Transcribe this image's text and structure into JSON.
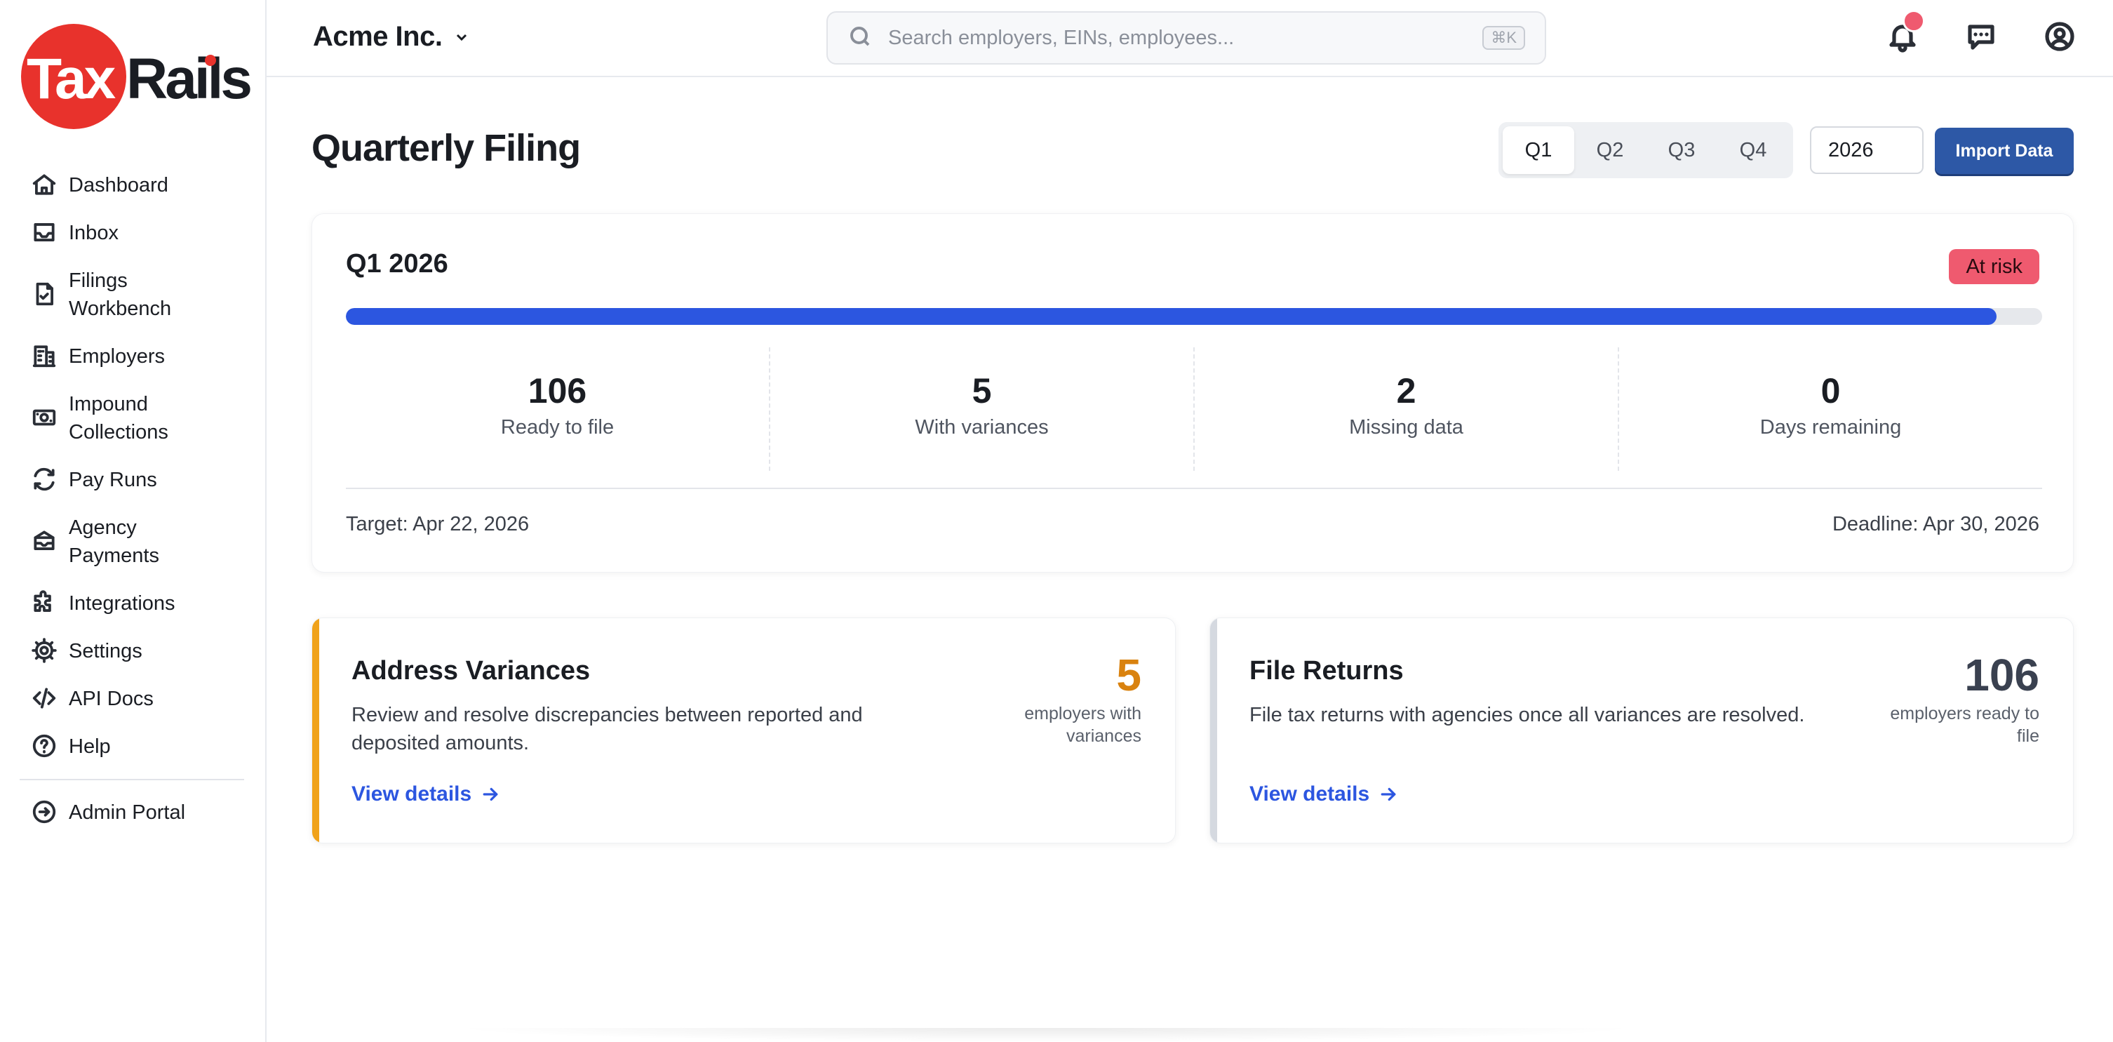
{
  "brand": {
    "logo_part1": "Tax",
    "logo_part2": "Rails",
    "accent_color": "#e8322c"
  },
  "sidebar": {
    "items": [
      {
        "label": "Dashboard",
        "icon": "home-icon"
      },
      {
        "label": "Inbox",
        "icon": "inbox-icon"
      },
      {
        "label": "Filings Workbench",
        "icon": "file-check-icon"
      },
      {
        "label": "Employers",
        "icon": "building-icon"
      },
      {
        "label": "Impound Collections",
        "icon": "money-icon"
      },
      {
        "label": "Pay Runs",
        "icon": "refresh-icon"
      },
      {
        "label": "Agency Payments",
        "icon": "bank-icon"
      },
      {
        "label": "Integrations",
        "icon": "puzzle-icon"
      },
      {
        "label": "Settings",
        "icon": "gear-icon"
      },
      {
        "label": "API Docs",
        "icon": "code-icon"
      },
      {
        "label": "Help",
        "icon": "help-icon"
      }
    ],
    "footer_item": {
      "label": "Admin Portal",
      "icon": "arrow-circle-icon"
    }
  },
  "header": {
    "org_name": "Acme Inc.",
    "search_placeholder": "Search employers, EINs, employees...",
    "search_shortcut": "⌘K"
  },
  "page": {
    "title": "Quarterly Filing",
    "quarters": [
      "Q1",
      "Q2",
      "Q3",
      "Q4"
    ],
    "selected_quarter": "Q1",
    "year": "2026",
    "import_label": "Import Data"
  },
  "summary": {
    "period": "Q1 2026",
    "status": "At risk",
    "status_color": "#ef5a6f",
    "progress_fraction": 0.973,
    "stats": [
      {
        "value": "106",
        "label": "Ready to file"
      },
      {
        "value": "5",
        "label": "With variances"
      },
      {
        "value": "2",
        "label": "Missing data"
      },
      {
        "value": "0",
        "label": "Days remaining"
      }
    ],
    "target": "Target: Apr 22, 2026",
    "deadline": "Deadline: Apr 30, 2026"
  },
  "cards": [
    {
      "title": "Address Variances",
      "description": "Review and resolve discrepancies between reported and deposited amounts.",
      "count": "5",
      "count_label": "employers with variances",
      "link": "View details",
      "accent": "#f0a21a",
      "count_color": "#d9820f"
    },
    {
      "title": "File Returns",
      "description": "File tax returns with agencies once all variances are resolved.",
      "count": "106",
      "count_label": "employers ready to file",
      "link": "View details",
      "accent": "#d5d9e0",
      "count_color": "#3a4150"
    }
  ]
}
